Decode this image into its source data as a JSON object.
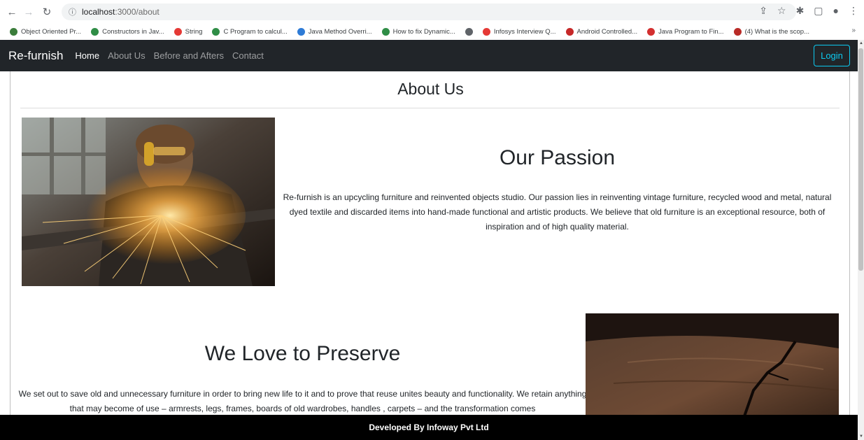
{
  "browser": {
    "url_host": "localhost",
    "url_path": ":3000/about",
    "bookmarks": [
      {
        "label": "Object Oriented Pr...",
        "icon": "glasses-icon",
        "color": "#3b7d3b"
      },
      {
        "label": "Constructors in Jav...",
        "icon": "gfg-icon",
        "color": "#2f8d46"
      },
      {
        "label": "String",
        "icon": "v-icon",
        "color": "#e53935"
      },
      {
        "label": "C Program to calcul...",
        "icon": "gfg-icon",
        "color": "#2f8d46"
      },
      {
        "label": "Java Method Overri...",
        "icon": "diamond-icon",
        "color": "#2e7bd6"
      },
      {
        "label": "How to fix Dynamic...",
        "icon": "gfg-icon",
        "color": "#2f8d46"
      },
      {
        "label": "",
        "icon": "globe-icon",
        "color": "#5f6368"
      },
      {
        "label": "Infosys Interview Q...",
        "icon": "v-icon",
        "color": "#e53935"
      },
      {
        "label": "Android Controlled...",
        "icon": "e-icon",
        "color": "#c62828"
      },
      {
        "label": "Java Program to Fin...",
        "icon": "tg-icon",
        "color": "#d32f2f"
      },
      {
        "label": "(4) What is the scop...",
        "icon": "quora-icon",
        "color": "#b92b27"
      }
    ],
    "more": "»"
  },
  "navbar": {
    "brand": "Re-furnish",
    "links": [
      {
        "label": "Home",
        "active": true
      },
      {
        "label": "About Us",
        "active": false
      },
      {
        "label": "Before and Afters",
        "active": false
      },
      {
        "label": "Contact",
        "active": false
      }
    ],
    "login": "Login",
    "accent": "#0dcaf0"
  },
  "main": {
    "title": "About Us",
    "sections": [
      {
        "heading": "Our Passion",
        "text": "Re-furnish is an upcycling furniture and reinvented objects studio. Our passion lies in reinventing vintage furniture, recycled wood and metal, natural dyed textile and discarded items into hand-made functional and artistic products. We believe that old furniture is an exceptional resource, both of inspiration and of high quality material."
      },
      {
        "heading": "We Love to Preserve",
        "text": "We set out to save old and unnecessary furniture in order to bring new life to it and to prove that reuse unites beauty and functionality. We retain anything that may become of use – armrests, legs, frames, boards of old wardrobes, handles , carpets – and the transformation comes"
      }
    ]
  },
  "footer": {
    "text": "Developed By Infoway Pvt Ltd"
  }
}
